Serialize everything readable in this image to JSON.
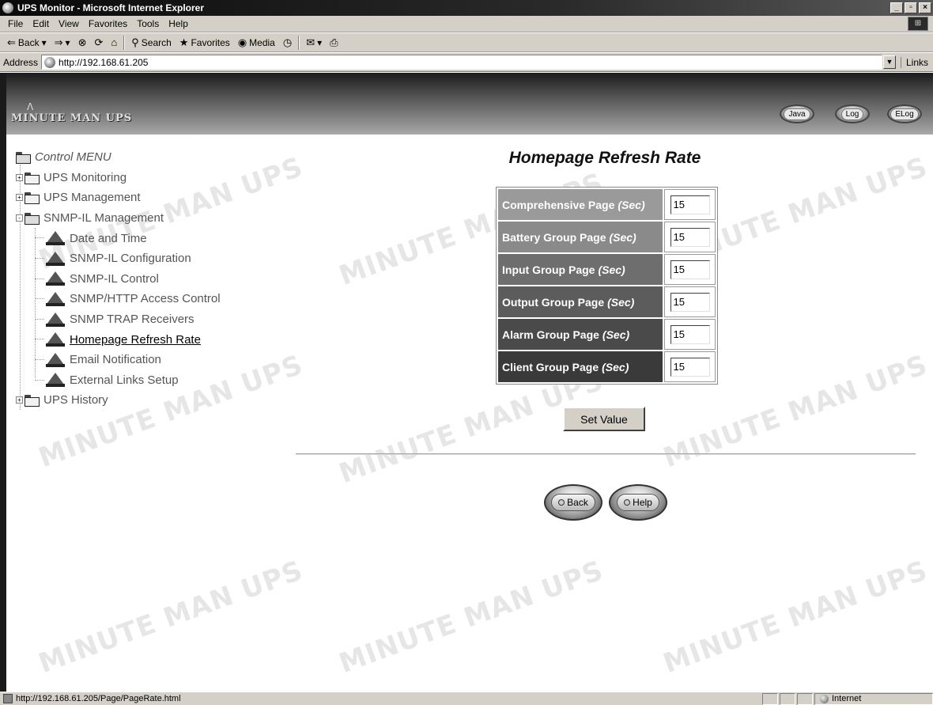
{
  "window": {
    "title": "UPS Monitor - Microsoft Internet Explorer",
    "controls": [
      "_",
      "▫",
      "×"
    ]
  },
  "menubar": [
    "File",
    "Edit",
    "View",
    "Favorites",
    "Tools",
    "Help"
  ],
  "toolbar": {
    "back": "Back",
    "search": "Search",
    "favorites": "Favorites",
    "media": "Media"
  },
  "address": {
    "label": "Address",
    "url": "http://192.168.61.205",
    "links": "Links"
  },
  "header": {
    "brand": "MINUTE MAN UPS",
    "buttons": [
      "Java",
      "Log",
      "ELog"
    ]
  },
  "watermark": "MINUTE MAN UPS",
  "tree": {
    "root": "Control MENU",
    "items": [
      {
        "label": "UPS Monitoring",
        "level": 1,
        "type": "folder",
        "expander": "+"
      },
      {
        "label": "UPS Management",
        "level": 1,
        "type": "folder",
        "expander": "+"
      },
      {
        "label": "SNMP-IL Management",
        "level": 1,
        "type": "folder-open",
        "expander": "-"
      },
      {
        "label": "Date and Time",
        "level": 2,
        "type": "page"
      },
      {
        "label": "SNMP-IL Configuration",
        "level": 2,
        "type": "page"
      },
      {
        "label": "SNMP-IL Control",
        "level": 2,
        "type": "page"
      },
      {
        "label": "SNMP/HTTP Access Control",
        "level": 2,
        "type": "page"
      },
      {
        "label": "SNMP TRAP Receivers",
        "level": 2,
        "type": "page"
      },
      {
        "label": "Homepage Refresh Rate",
        "level": 2,
        "type": "page",
        "active": true
      },
      {
        "label": "Email Notification",
        "level": 2,
        "type": "page"
      },
      {
        "label": "External Links Setup",
        "level": 2,
        "type": "page"
      },
      {
        "label": "UPS History",
        "level": 1,
        "type": "folder",
        "expander": "+"
      }
    ]
  },
  "main": {
    "title": "Homepage Refresh Rate",
    "unit": "(Sec)",
    "rows": [
      {
        "label": "Comprehensive Page",
        "value": "15",
        "color": "#9a9a9a"
      },
      {
        "label": "Battery Group Page",
        "value": "15",
        "color": "#8a8a8a"
      },
      {
        "label": "Input Group Page",
        "value": "15",
        "color": "#6e6e6e"
      },
      {
        "label": "Output Group Page",
        "value": "15",
        "color": "#5c5c5c"
      },
      {
        "label": "Alarm Group Page",
        "value": "15",
        "color": "#4a4a4a"
      },
      {
        "label": "Client Group Page",
        "value": "15",
        "color": "#3a3a3a"
      }
    ],
    "set_button": "Set Value",
    "back_button": "Back",
    "help_button": "Help"
  },
  "status": {
    "text": "http://192.168.61.205/Page/PageRate.html",
    "zone": "Internet"
  }
}
